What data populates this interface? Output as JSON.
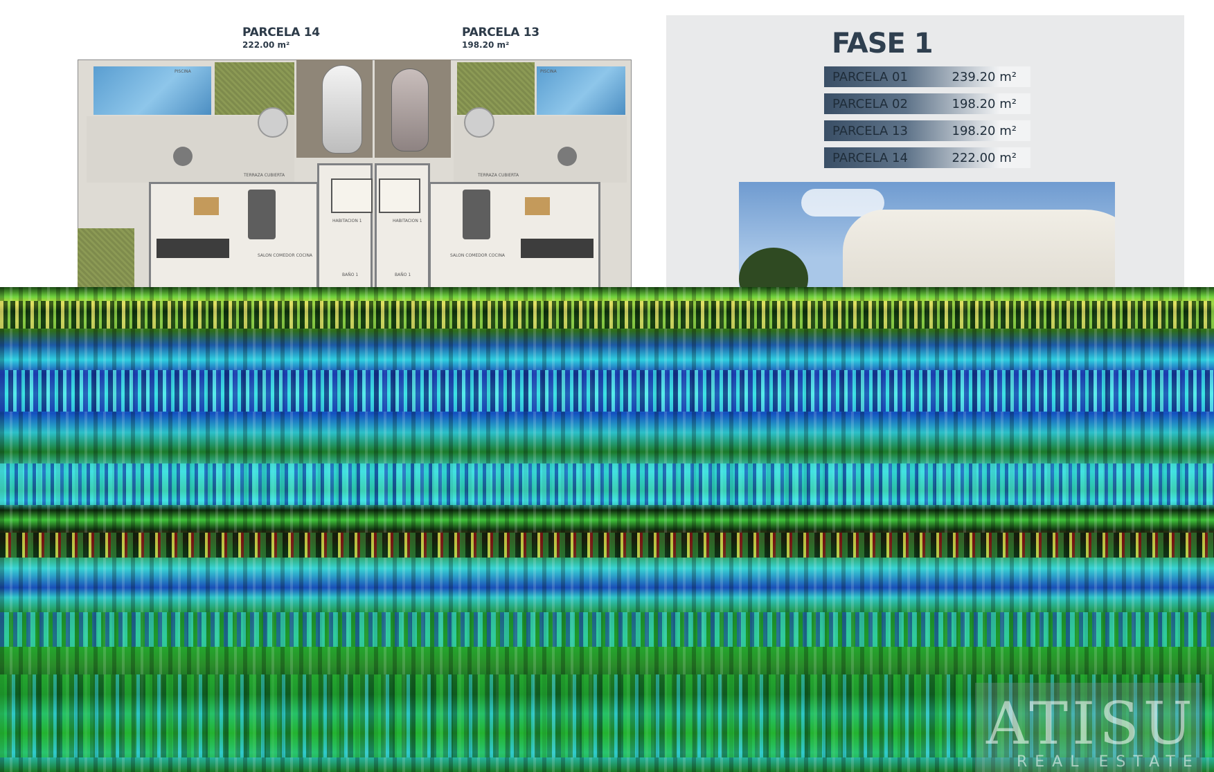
{
  "plan": {
    "left_parcel": {
      "title": "PARCELA 14",
      "area": "222.00 m²"
    },
    "right_parcel": {
      "title": "PARCELA 13",
      "area": "198.20 m²"
    },
    "rooms": {
      "terrace_left": "TERRAZA CUBIERTA",
      "terrace_right": "TERRAZA CUBIERTA",
      "living_left": "SALON COMEDOR COCINA",
      "living_right": "SALON COMEDOR COCINA",
      "bedroom_left": "HABITACION 1",
      "bedroom_right": "HABITACION 1",
      "bath_left": "BAÑO 1",
      "bath_right": "BAÑO 1",
      "pool_left": "PISCINA",
      "pool_right": "PISCINA"
    }
  },
  "fase": {
    "title": "FASE 1",
    "parcels": [
      {
        "name": "PARCELA 01",
        "area": "239.20 m²"
      },
      {
        "name": "PARCELA 02",
        "area": "198.20 m²"
      },
      {
        "name": "PARCELA 13",
        "area": "198.20 m²"
      },
      {
        "name": "PARCELA 14",
        "area": "222.00 m²"
      }
    ]
  },
  "watermark": {
    "name": "ATISU",
    "tagline": "REAL ESTATE"
  },
  "colors": {
    "title": "#2f3f4f",
    "row_dark": "#3a4f66",
    "row_light": "#f2f3f4",
    "panel": "#e9eaeb"
  }
}
